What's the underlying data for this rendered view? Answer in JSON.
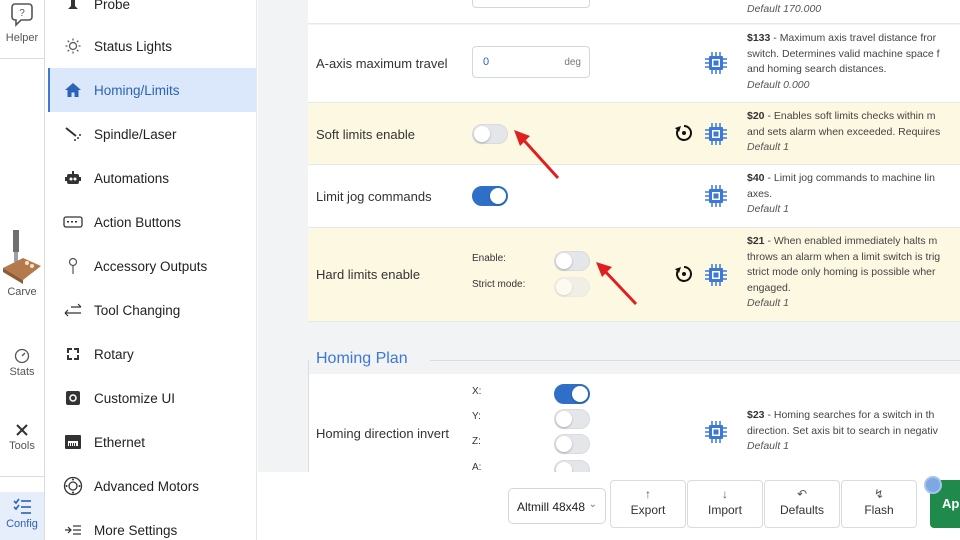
{
  "rail": {
    "items": [
      {
        "label": "Helper",
        "icon": "chat-question-icon"
      },
      {
        "label": "Carve",
        "icon": "carve-machine-icon"
      },
      {
        "label": "Stats",
        "icon": "gauge-icon"
      },
      {
        "label": "Tools",
        "icon": "tools-icon"
      },
      {
        "label": "Config",
        "icon": "config-list-icon"
      }
    ]
  },
  "sidebar": {
    "items": [
      {
        "label": "Probe",
        "icon": "probe-icon"
      },
      {
        "label": "Status Lights",
        "icon": "sun-icon"
      },
      {
        "label": "Homing/Limits",
        "icon": "home-icon"
      },
      {
        "label": "Spindle/Laser",
        "icon": "spindle-icon"
      },
      {
        "label": "Automations",
        "icon": "robot-icon"
      },
      {
        "label": "Action Buttons",
        "icon": "keyboard-icon"
      },
      {
        "label": "Accessory Outputs",
        "icon": "pin-icon"
      },
      {
        "label": "Tool Changing",
        "icon": "swap-arrows-icon"
      },
      {
        "label": "Rotary",
        "icon": "rotary-icon"
      },
      {
        "label": "Customize UI",
        "icon": "customize-icon"
      },
      {
        "label": "Ethernet",
        "icon": "ethernet-icon"
      },
      {
        "label": "Advanced Motors",
        "icon": "motor-icon"
      },
      {
        "label": "More Settings",
        "icon": "more-settings-icon"
      }
    ]
  },
  "settings": {
    "prev_default": "Default 170.000",
    "a_axis": {
      "label": "A-axis maximum travel",
      "value": "0",
      "unit": "deg",
      "code": "$133",
      "desc1": " - Maximum axis travel distance fror",
      "desc2": "switch. Determines valid machine space f",
      "desc3": "and homing search distances.",
      "default": "Default 0.000"
    },
    "soft_limits": {
      "label": "Soft limits enable",
      "code": "$20",
      "desc1": " - Enables soft limits checks within m",
      "desc2": "and sets alarm when exceeded. Requires",
      "default": "Default 1"
    },
    "limit_jog": {
      "label": "Limit jog commands",
      "code": "$40",
      "desc1": " - Limit jog commands to machine lin",
      "desc2": "axes.",
      "default": "Default 1"
    },
    "hard_limits": {
      "label": "Hard limits enable",
      "enable_label": "Enable:",
      "strict_label": "Strict mode:",
      "code": "$21",
      "desc1": " - When enabled immediately halts m",
      "desc2": "throws an alarm when a limit switch is trig",
      "desc3": "strict mode only homing is possible wher",
      "desc4": "engaged.",
      "default": "Default 1"
    },
    "homing_plan": {
      "title": "Homing Plan",
      "dir_invert": {
        "label": "Homing direction invert",
        "x": "X:",
        "y": "Y:",
        "z": "Z:",
        "a": "A:",
        "code": "$23",
        "desc1": " - Homing searches for a switch in th",
        "desc2": "direction. Set axis bit to search in negativ",
        "default": "Default 1"
      }
    }
  },
  "toolbar": {
    "machine": "Altmill 48x48",
    "buttons": [
      {
        "label": "Export",
        "icon": "export-icon"
      },
      {
        "label": "Import",
        "icon": "import-icon"
      },
      {
        "label": "Defaults",
        "icon": "undo-icon"
      },
      {
        "label": "Flash",
        "icon": "flash-icon"
      }
    ],
    "apply": "Ap"
  },
  "colors": {
    "accent": "#3b78d8",
    "highlight_row": "#fdf8e2",
    "apply": "#1f8a4c",
    "arrow": "#e02020"
  }
}
